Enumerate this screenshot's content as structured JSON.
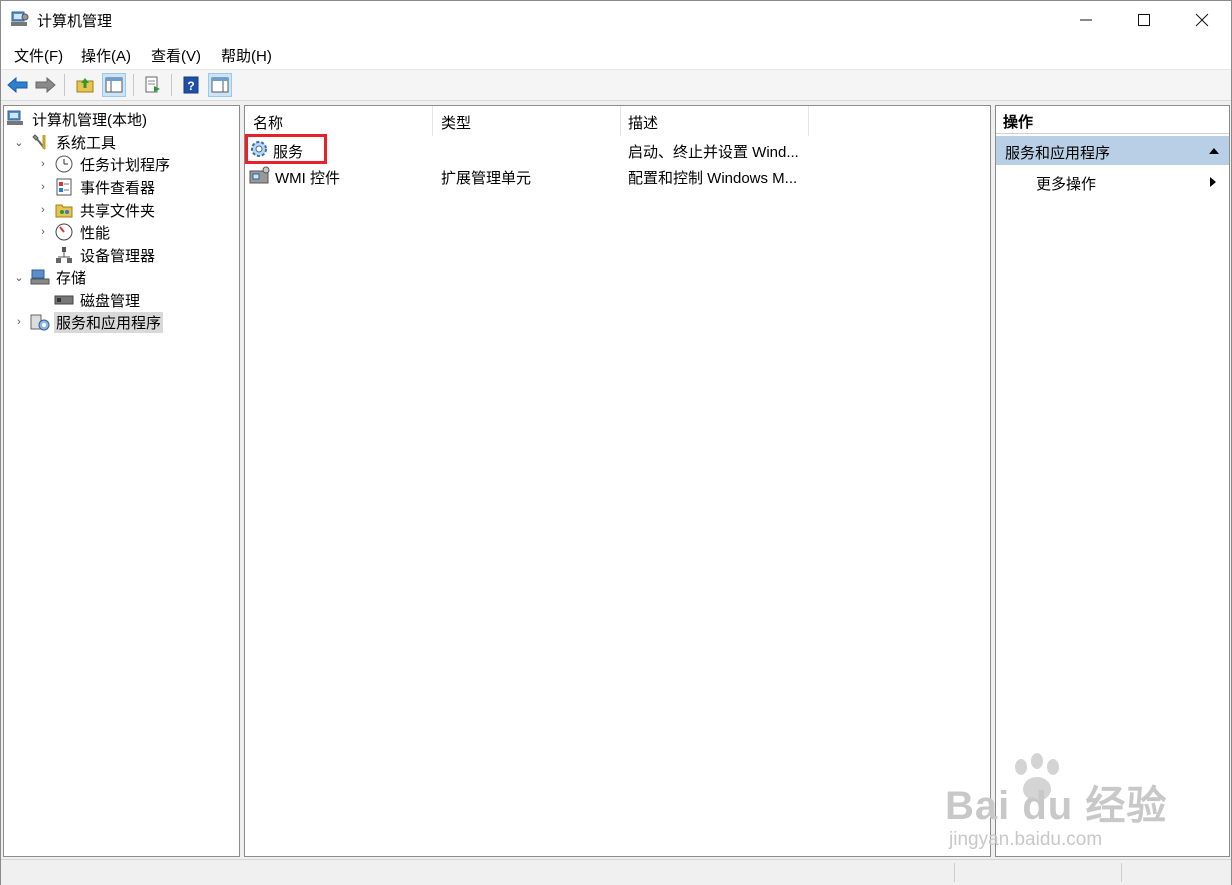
{
  "window": {
    "title": "计算机管理"
  },
  "menu": [
    {
      "label": "文件(F)"
    },
    {
      "label": "操作(A)"
    },
    {
      "label": "查看(V)"
    },
    {
      "label": "帮助(H)"
    }
  ],
  "tree": {
    "root": "计算机管理(本地)",
    "items": [
      {
        "label": "系统工具",
        "expander": "expanded",
        "icon": "tools-icon"
      },
      {
        "label": "任务计划程序",
        "expander": "collapsed",
        "icon": "clock-icon"
      },
      {
        "label": "事件查看器",
        "expander": "collapsed",
        "icon": "event-viewer-icon"
      },
      {
        "label": "共享文件夹",
        "expander": "collapsed",
        "icon": "shared-folder-icon"
      },
      {
        "label": "性能",
        "expander": "collapsed",
        "icon": "performance-icon"
      },
      {
        "label": "设备管理器",
        "expander": "none",
        "icon": "device-manager-icon"
      },
      {
        "label": "存储",
        "expander": "expanded",
        "icon": "storage-icon"
      },
      {
        "label": "磁盘管理",
        "expander": "none",
        "icon": "disk-icon"
      },
      {
        "label": "服务和应用程序",
        "expander": "collapsed",
        "icon": "services-apps-icon",
        "selected": true
      }
    ]
  },
  "list": {
    "columns": [
      "名称",
      "类型",
      "描述"
    ],
    "rows": [
      {
        "name": "服务",
        "type": "",
        "desc": "启动、终止并设置 Wind...",
        "icon": "gear-icon"
      },
      {
        "name": "WMI 控件",
        "type": "扩展管理单元",
        "desc": "配置和控制 Windows M...",
        "icon": "wmi-icon"
      }
    ]
  },
  "actions": {
    "header": "操作",
    "section": "服务和应用程序",
    "item": "更多操作"
  },
  "watermark": {
    "big": "Bai du 经验",
    "small": "jingyan.baidu.com"
  },
  "colors": {
    "selection_section": "#b9cfe6",
    "highlight": "#e8202a"
  }
}
